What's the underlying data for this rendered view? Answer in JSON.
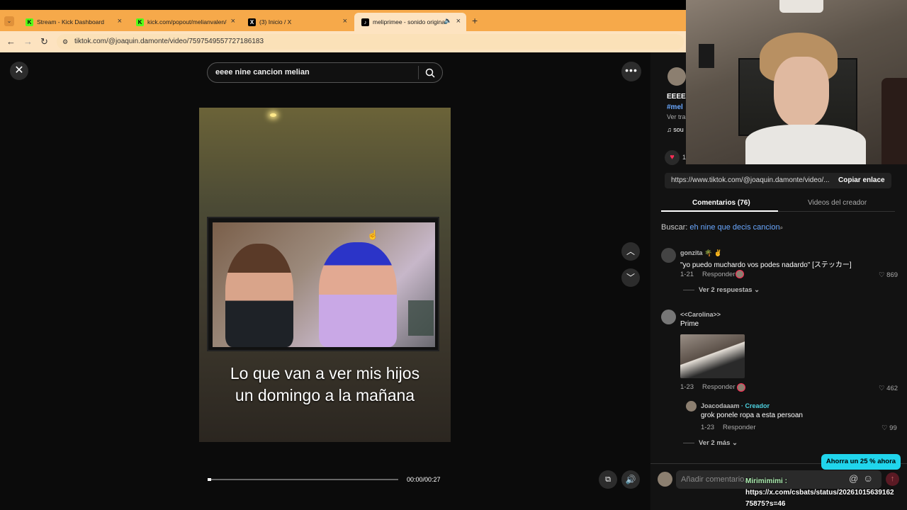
{
  "browser": {
    "tabs": [
      {
        "title": "Stream - Kick Dashboard",
        "icon": "kick-icon"
      },
      {
        "title": "kick.com/popout/melianvalen/c",
        "icon": "kick-icon"
      },
      {
        "title": "(3) Inicio / X",
        "icon": "x-icon"
      },
      {
        "title": "meliprimee - sonido original",
        "icon": "tiktok-icon"
      }
    ],
    "new_tab": "+",
    "url": "tiktok.com/@joaquin.damonte/video/7597549557727186183"
  },
  "player": {
    "search_value": "eeee nine cancion melian",
    "caption_line1": "Lo que van a ver mis hijos",
    "caption_line2": "un domingo a la mañana",
    "time": "00:00/00:27",
    "progress_fraction": 0.02
  },
  "panel": {
    "desc_line1": "EEEE",
    "desc_hashtag": "#mel",
    "desc_translate": "Ver tra",
    "desc_sound": "♫ sou",
    "likes": "1",
    "link": "https://www.tiktok.com/@joaquin.damonte/video/...",
    "copy_label": "Copiar enlace",
    "tab_comments": "Comentarios (76)",
    "tab_videos": "Videos del creador",
    "search_prefix": "Buscar:",
    "search_suggestion": "eh nine que decis cancion",
    "comments": [
      {
        "user": "gonzita 🌴 ✌",
        "text": "\"yo puedo muchardo vos podes nadardo\" [ステッカー]",
        "date": "1-21",
        "reply": "Responder",
        "likes": "869",
        "more": "Ver 2 respuestas"
      },
      {
        "user": "<<Carolina>>",
        "text": "Prime",
        "date": "1-23",
        "reply": "Responder",
        "likes": "462"
      },
      {
        "user": "Joacodaaam",
        "creator": "· Creador",
        "text": "grok ponele ropa a esta persoan",
        "date": "1-23",
        "reply": "Responder",
        "likes": "99",
        "more": "Ver 2 más"
      }
    ],
    "comment_placeholder": "Añadir comentario...",
    "promo": "Ahorra un 25 % ahora"
  },
  "chat_overlay": {
    "user": "Mirimimimi :",
    "line1": "https://x.com/csbats/status/20261015639162",
    "line2": "75875?s=46"
  },
  "colors": {
    "tab_bar": "#f6a94a",
    "tiktok_red": "#fe2c55",
    "link_blue": "#6aa8ff",
    "promo_cyan": "#20d5ec"
  }
}
